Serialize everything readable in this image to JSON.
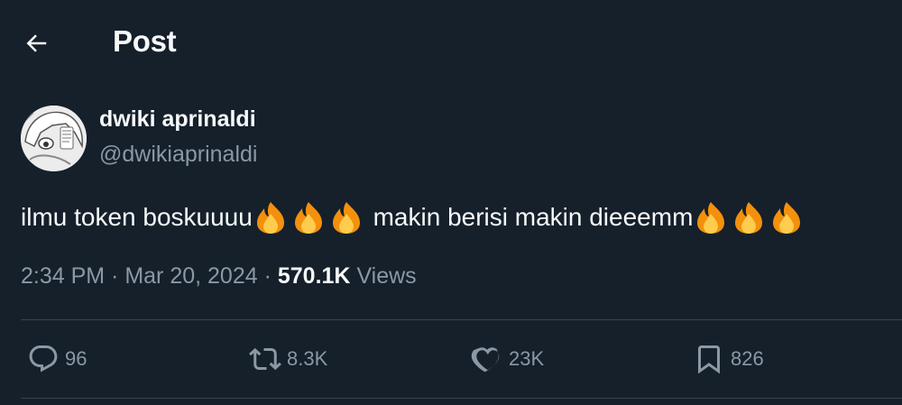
{
  "header": {
    "title": "Post",
    "back_icon": "arrow-left-icon"
  },
  "author": {
    "name": "dwiki aprinaldi",
    "handle": "@dwikiaprinaldi"
  },
  "tweet": {
    "text_part1": "ilmu token boskuuuu",
    "text_part2": " makin berisi makin dieeemm",
    "emoji": "fire"
  },
  "meta": {
    "time": "2:34 PM",
    "sep1": " · ",
    "date": "Mar 20, 2024",
    "sep2": " · ",
    "views_count": "570.1K",
    "views_label": " Views"
  },
  "actions": {
    "replies": "96",
    "reposts": "8.3K",
    "likes": "23K",
    "bookmarks": "826"
  },
  "colors": {
    "background": "#15202b",
    "text": "#f7f9f9",
    "muted": "#8b98a5",
    "divider": "#38444d"
  }
}
